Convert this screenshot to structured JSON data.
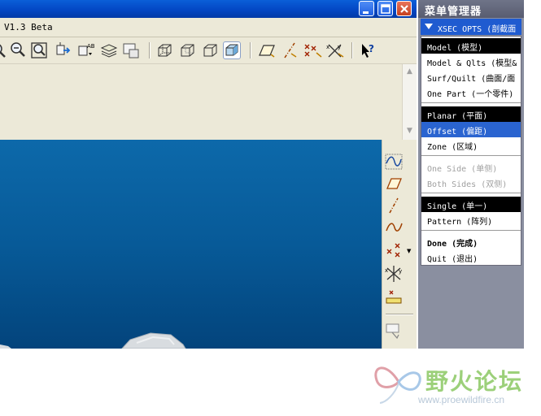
{
  "window": {
    "version_text": "V1.3 Beta",
    "controls": [
      "minimize-icon",
      "maximize-icon",
      "close-icon"
    ]
  },
  "toolbar": {
    "icons": [
      "zoom-partial-icon",
      "zoom-out-icon",
      "zoom-fit-icon",
      "reorient-icon",
      "saved-views-icon",
      "layers-icon",
      "model-display-icon",
      "wireframe-icon",
      "hidden-line-icon",
      "no-hidden-icon",
      "shading-icon",
      "datum-planes-icon",
      "datum-axes-icon",
      "datum-points-icon",
      "coordinate-systems-icon",
      "context-help-icon"
    ]
  },
  "right_toolbar": {
    "icons": [
      "sketch-curve-icon",
      "datum-plane-icon",
      "datum-axis-icon",
      "datum-curve-icon",
      "datum-point-icon",
      "coordinate-system-icon",
      "analysis-icon",
      "annotation-icon"
    ]
  },
  "menu_manager": {
    "title": "菜单管理器",
    "section_title": "XSEC OPTS (剖截面",
    "items": [
      {
        "label": "Model (模型)",
        "state": "header"
      },
      {
        "label": "Model & Qlts (模型&",
        "state": "normal"
      },
      {
        "label": "Surf/Quilt (曲面/面",
        "state": "normal"
      },
      {
        "label": "One Part (一个零件)",
        "state": "normal"
      },
      {
        "label": "Planar (平面)",
        "state": "header"
      },
      {
        "label": "Offset (偏距)",
        "state": "selected"
      },
      {
        "label": "Zone (区域)",
        "state": "normal"
      },
      {
        "label": "One Side (单侧)",
        "state": "disabled"
      },
      {
        "label": "Both Sides (双侧)",
        "state": "disabled"
      },
      {
        "label": "Single (单一)",
        "state": "header"
      },
      {
        "label": "Pattern (阵列)",
        "state": "normal"
      },
      {
        "label": "Done (完成)",
        "state": "bold"
      },
      {
        "label": "Quit (退出)",
        "state": "normal"
      }
    ]
  },
  "watermark": {
    "text": "野火论坛",
    "url": "www.proewildfire.cn"
  },
  "colors": {
    "viewport_top": "#0d69aa",
    "viewport_bottom": "#03447c",
    "selected": "#2a64d0",
    "title_blue": "#0347c4"
  }
}
